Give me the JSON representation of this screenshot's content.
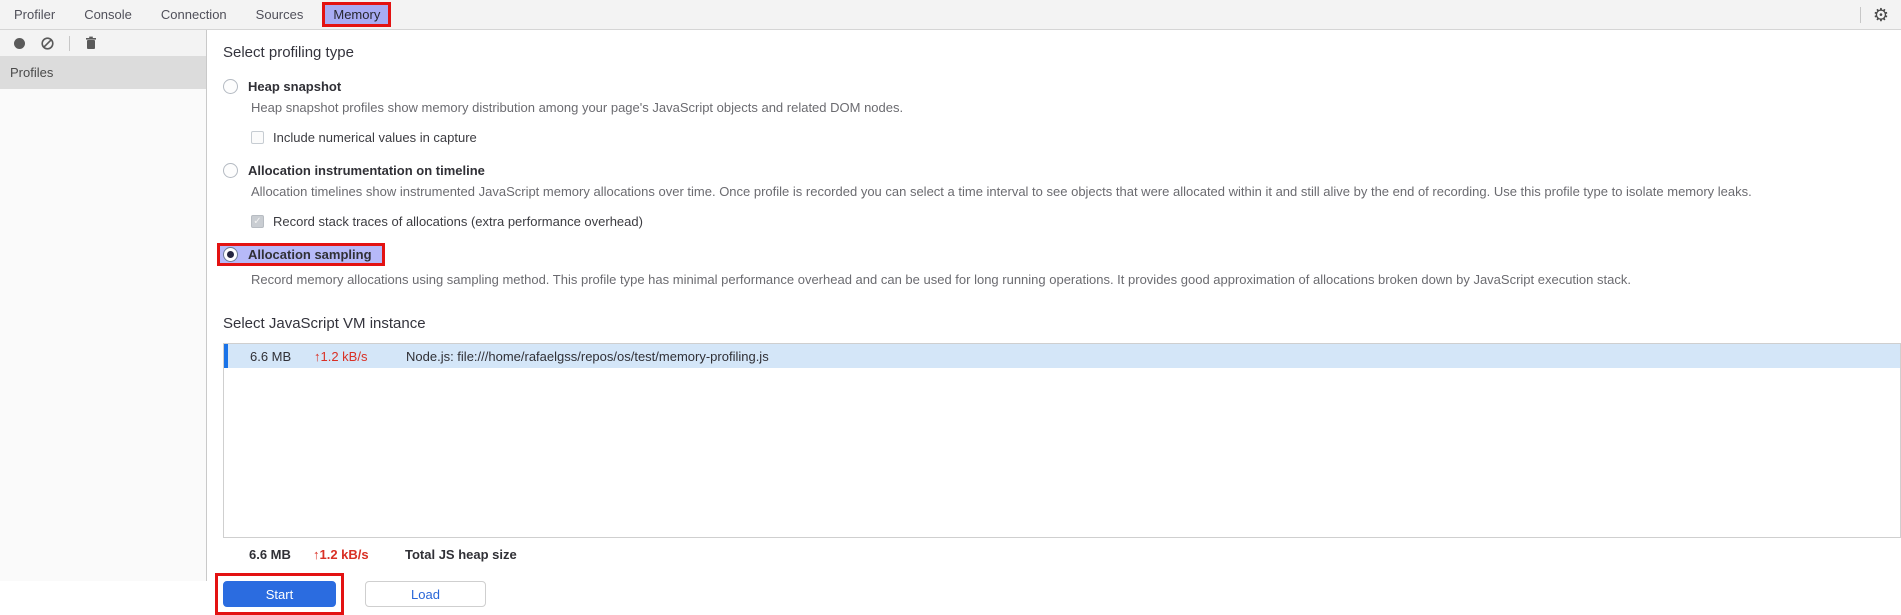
{
  "tabs": {
    "items": [
      {
        "label": "Profiler",
        "active": false
      },
      {
        "label": "Console",
        "active": false
      },
      {
        "label": "Connection",
        "active": false
      },
      {
        "label": "Sources",
        "active": false
      },
      {
        "label": "Memory",
        "active": true
      }
    ]
  },
  "icons": {
    "record": "filled-circle",
    "clear": "circle-slash",
    "delete": "trash",
    "settings": "gear",
    "gear_glyph": "⚙",
    "check": "✓",
    "up_arrow": "↑"
  },
  "sidebar": {
    "header": "Profiles"
  },
  "profiling": {
    "title": "Select profiling type",
    "options": [
      {
        "label": "Heap snapshot",
        "selected": false,
        "description": "Heap snapshot profiles show memory distribution among your page's JavaScript objects and related DOM nodes.",
        "sub_checkbox": {
          "label": "Include numerical values in capture",
          "checked": false
        }
      },
      {
        "label": "Allocation instrumentation on timeline",
        "selected": false,
        "description": "Allocation timelines show instrumented JavaScript memory allocations over time. Once profile is recorded you can select a time interval to see objects that were allocated within it and still alive by the end of recording. Use this profile type to isolate memory leaks.",
        "sub_checkbox": {
          "label": "Record stack traces of allocations (extra performance overhead)",
          "checked": true
        }
      },
      {
        "label": "Allocation sampling",
        "selected": true,
        "description": "Record memory allocations using sampling method. This profile type has minimal performance overhead and can be used for long running operations. It provides good approximation of allocations broken down by JavaScript execution stack."
      }
    ]
  },
  "vm": {
    "title": "Select JavaScript VM instance",
    "instances": [
      {
        "size": "6.6 MB",
        "rate": "↑1.2 kB/s",
        "name": "Node.js: file:///home/rafaelgss/repos/os/test/memory-profiling.js",
        "selected": true
      }
    ],
    "total": {
      "size": "6.6 MB",
      "rate": "↑1.2 kB/s",
      "label": "Total JS heap size"
    }
  },
  "actions": {
    "start": "Start",
    "load": "Load"
  },
  "colors": {
    "annotation_red": "#e31212",
    "tab_highlight": "#a8abf3",
    "sampling_highlight": "#b6b9f8",
    "row_selected_bg": "#d4e6f8",
    "selection_accent_blue": "#1a73e8",
    "rate_red": "#d93025",
    "start_button_blue": "#2b6ce0"
  }
}
